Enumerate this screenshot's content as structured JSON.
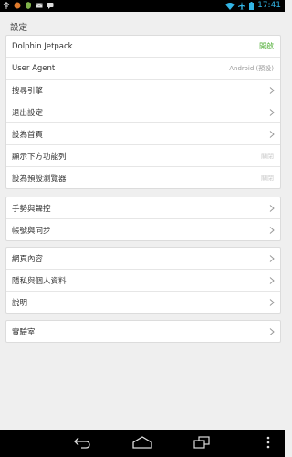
{
  "status_bar": {
    "time": "17:41",
    "icons": [
      "usb-icon",
      "notification-icon",
      "shield-icon",
      "gmail-icon",
      "chat-icon",
      "wifi-icon",
      "airplane-icon",
      "battery-icon"
    ]
  },
  "page_title": "設定",
  "groups": [
    {
      "rows": [
        {
          "label": "Dolphin Jetpack",
          "value": "開啟",
          "value_style": "green"
        },
        {
          "label": "User Agent",
          "value": "Android (預設)",
          "value_style": "gray"
        },
        {
          "label": "搜尋引擎",
          "chevron": true
        },
        {
          "label": "退出設定",
          "chevron": true
        },
        {
          "label": "設為首頁",
          "chevron": true
        },
        {
          "label": "顯示下方功能列",
          "value": "關閉",
          "value_style": "light"
        },
        {
          "label": "設為預設瀏覽器",
          "value": "關閉",
          "value_style": "light"
        }
      ]
    },
    {
      "rows": [
        {
          "label": "手勢與聲控",
          "chevron": true
        },
        {
          "label": "帳號與同步",
          "chevron": true
        }
      ]
    },
    {
      "rows": [
        {
          "label": "網頁內容",
          "chevron": true
        },
        {
          "label": "隱私與個人資料",
          "chevron": true
        },
        {
          "label": "說明",
          "chevron": true
        }
      ]
    },
    {
      "rows": [
        {
          "label": "實驗室",
          "chevron": true
        }
      ]
    }
  ],
  "nav_bar": {
    "buttons": [
      "back-button",
      "home-button",
      "recent-apps-button",
      "menu-button"
    ]
  },
  "colors": {
    "accent_green": "#55b03b",
    "status_blue": "#33b5e5",
    "background": "#efefef"
  }
}
